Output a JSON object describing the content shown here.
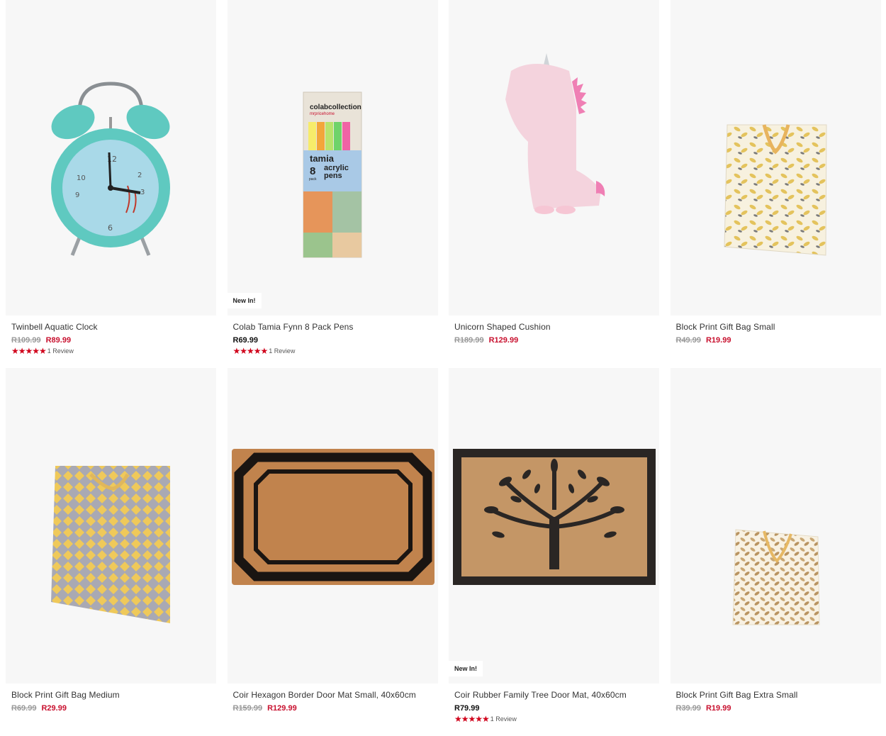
{
  "products": [
    {
      "name": "Twinbell Aquatic Clock",
      "old_price": "R109.99",
      "price": "R89.99",
      "stars": "★★★★★",
      "reviews": "1 Review",
      "badge": "",
      "image": "aquatic-alarm-clock"
    },
    {
      "name": "Colab Tamia Fynn 8 Pack Pens",
      "old_price": "",
      "price": "R69.99",
      "stars": "★★★★★",
      "reviews": "1 Review",
      "badge": "New In!",
      "image": "acrylic-pens-box"
    },
    {
      "name": "Unicorn Shaped Cushion",
      "old_price": "R189.99",
      "price": "R129.99",
      "stars": "",
      "reviews": "",
      "badge": "",
      "image": "unicorn-cushion"
    },
    {
      "name": "Block Print Gift Bag Small",
      "old_price": "R49.99",
      "price": "R19.99",
      "stars": "",
      "reviews": "",
      "badge": "",
      "image": "gift-bag-small"
    },
    {
      "name": "Block Print Gift Bag Medium",
      "old_price": "R69.99",
      "price": "R29.99",
      "stars": "",
      "reviews": "",
      "badge": "",
      "image": "gift-bag-medium"
    },
    {
      "name": "Coir Hexagon Border Door Mat Small, 40x60cm",
      "old_price": "R159.99",
      "price": "R129.99",
      "stars": "",
      "reviews": "",
      "badge": "",
      "image": "hexagon-door-mat"
    },
    {
      "name": "Coir Rubber Family Tree Door Mat, 40x60cm",
      "old_price": "",
      "price": "R79.99",
      "stars": "★★★★★",
      "reviews": "1 Review",
      "badge": "New In!",
      "image": "tree-door-mat"
    },
    {
      "name": "Block Print Gift Bag Extra Small",
      "old_price": "R39.99",
      "price": "R19.99",
      "stars": "",
      "reviews": "",
      "badge": "",
      "image": "gift-bag-extra-small"
    }
  ],
  "pen_box": {
    "brand": "colabcollection",
    "sub": "mrpricehome",
    "line1": "tamia",
    "count": "8",
    "count_unit": "pack",
    "line2": "acrylic",
    "line3": "pens"
  },
  "colors": {
    "sale": "#c8102e",
    "star": "#d0021b",
    "card_bg": "#f7f7f7"
  }
}
